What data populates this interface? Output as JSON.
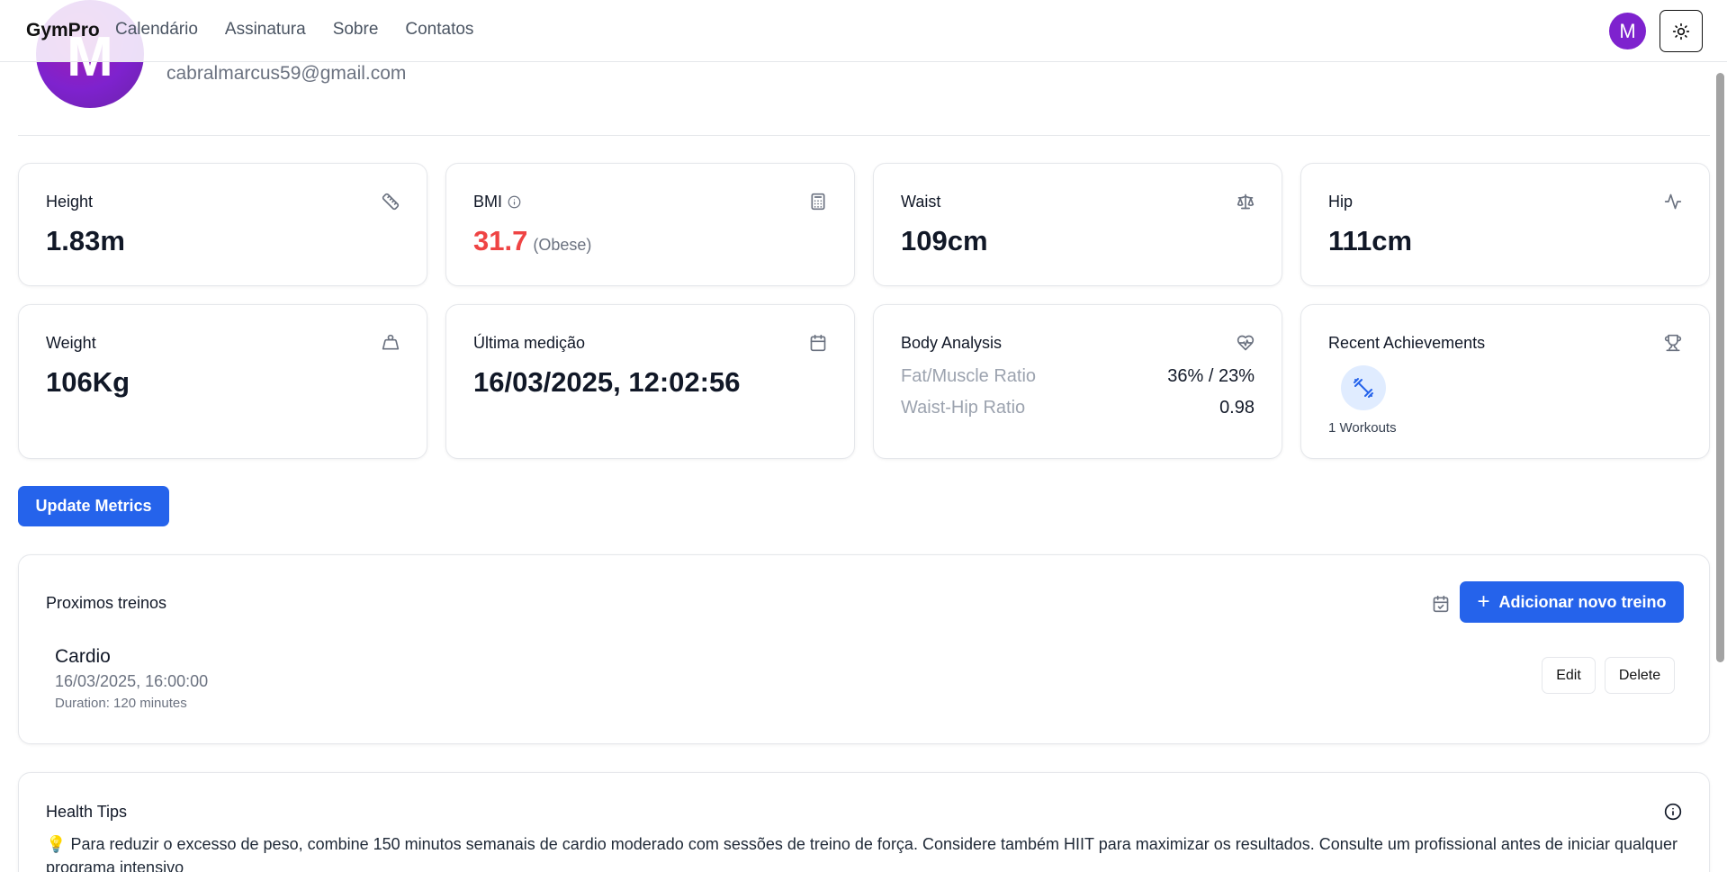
{
  "nav": {
    "brand": "GymPro",
    "links": [
      "Calendário",
      "Assinatura",
      "Sobre",
      "Contatos"
    ],
    "avatar_initial": "M",
    "theme_icon": "sun-icon"
  },
  "profile": {
    "avatar_initial": "M",
    "email": "cabralmarcus59@gmail.com"
  },
  "metrics": {
    "height": {
      "label": "Height",
      "value": "1.83m",
      "icon": "ruler-icon"
    },
    "bmi": {
      "label": "BMI",
      "value": "31.7",
      "note": "(Obese)",
      "icon": "calculator-icon",
      "info_icon": "info-icon",
      "value_color": "#ef4444"
    },
    "waist": {
      "label": "Waist",
      "value": "109cm",
      "icon": "scale-icon"
    },
    "hip": {
      "label": "Hip",
      "value": "111cm",
      "icon": "activity-icon"
    },
    "weight": {
      "label": "Weight",
      "value": "106Kg",
      "icon": "weight-icon"
    },
    "last": {
      "label": "Última medição",
      "value": "16/03/2025, 12:02:56",
      "icon": "calendar-icon"
    },
    "body": {
      "label": "Body Analysis",
      "icon": "heart-pulse-icon",
      "rows": [
        {
          "name": "Fat/Muscle Ratio",
          "value": "36% / 23%"
        },
        {
          "name": "Waist-Hip Ratio",
          "value": "0.98"
        }
      ]
    },
    "achievements": {
      "label": "Recent Achievements",
      "icon": "trophy-icon",
      "badge_icon": "dumbbell-icon",
      "text": "1 Workouts"
    }
  },
  "update_button": "Update Metrics",
  "upcoming": {
    "title": "Proximos treinos",
    "calendar_icon": "calendar-check-icon",
    "add_button": "Adicionar novo treino",
    "workout": {
      "name": "Cardio",
      "date": "16/03/2025, 16:00:00",
      "duration": "Duration: 120 minutes",
      "edit": "Edit",
      "delete": "Delete"
    }
  },
  "tips": {
    "title": "Health Tips",
    "icon": "info-icon",
    "emoji": "💡",
    "text": "Para reduzir o excesso de peso, combine 150 minutos semanais de cardio moderado com sessões de treino de força. Considere também HIIT para maximizar os resultados. Consulte um profissional antes de iniciar qualquer programa intensivo"
  },
  "colors": {
    "primary": "#2563eb",
    "avatar": "#7e22ce",
    "danger": "#ef4444"
  }
}
